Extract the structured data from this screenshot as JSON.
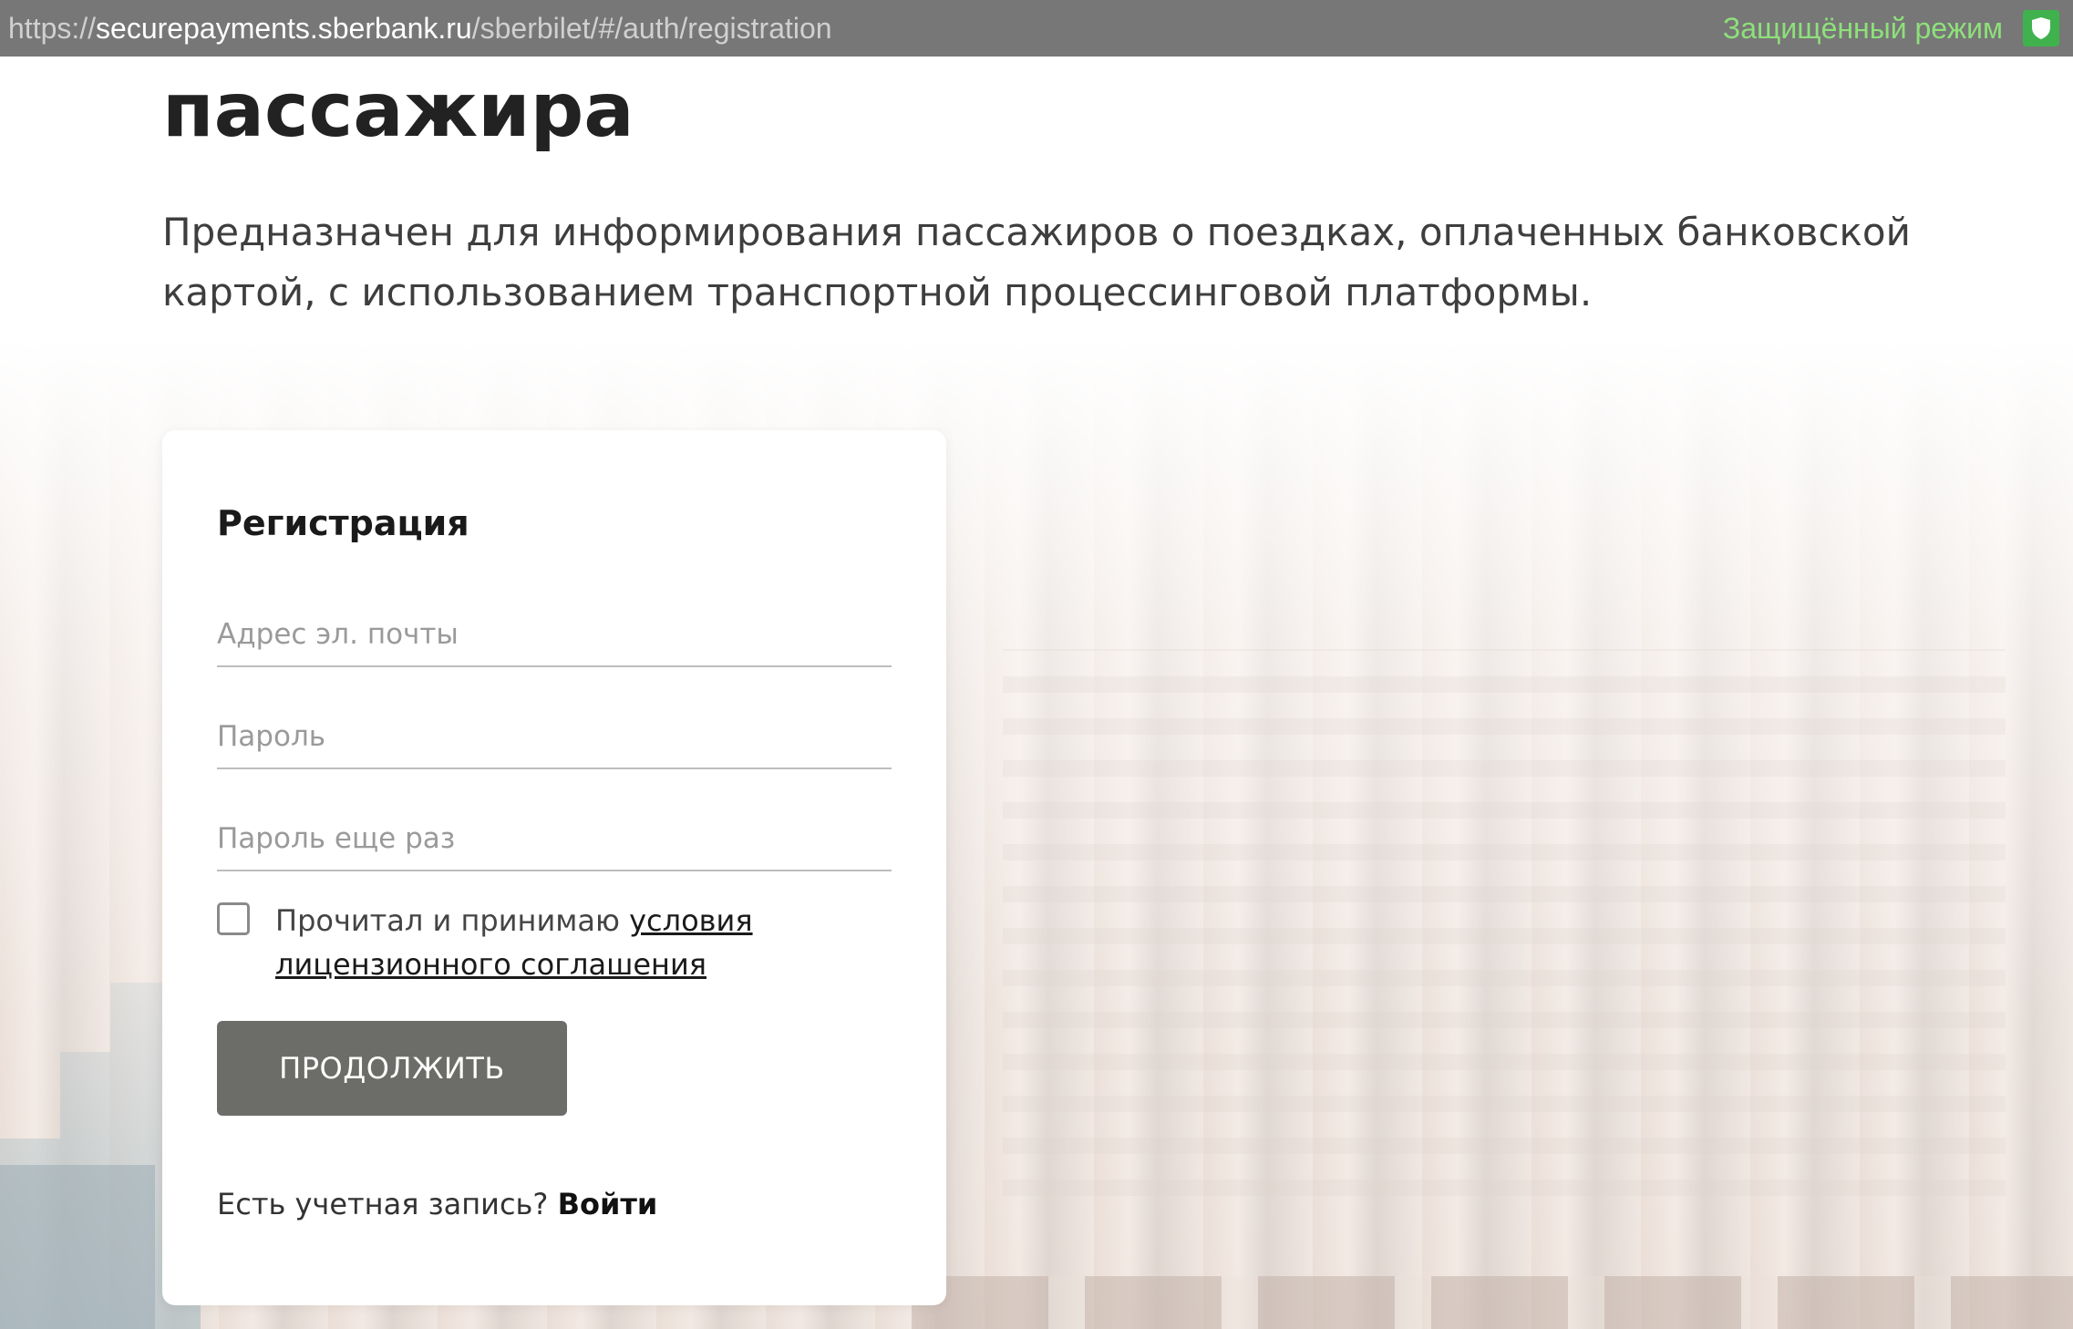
{
  "address_bar": {
    "scheme": "https://",
    "host": "securepayments.sberbank.ru",
    "path": "/sberbilet/#/auth/registration",
    "secure_mode_label": "Защищённый режим",
    "secure_icon": "shield-icon",
    "secure_color": "#8ee07a",
    "shield_color": "#3fb24d"
  },
  "page": {
    "heading": "пассажира",
    "description": "Предназначен для информирования пассажиров о поездках, оплаченных банковской картой, с использованием транспортной процессинговой платформы."
  },
  "registration_form": {
    "title": "Регистрация",
    "email": {
      "value": "",
      "placeholder": "Адрес эл. почты"
    },
    "password": {
      "value": "",
      "placeholder": "Пароль"
    },
    "password_repeat": {
      "value": "",
      "placeholder": "Пароль еще раз"
    },
    "agreement": {
      "checked": false,
      "prefix": "Прочитал и принимаю ",
      "link_text": "условия лицензионного соглашения"
    },
    "continue_label": "ПРОДОЛЖИТЬ",
    "continue_color": "#6c6d68",
    "login_prompt": "Есть учетная запись? ",
    "login_link": "Войти"
  }
}
